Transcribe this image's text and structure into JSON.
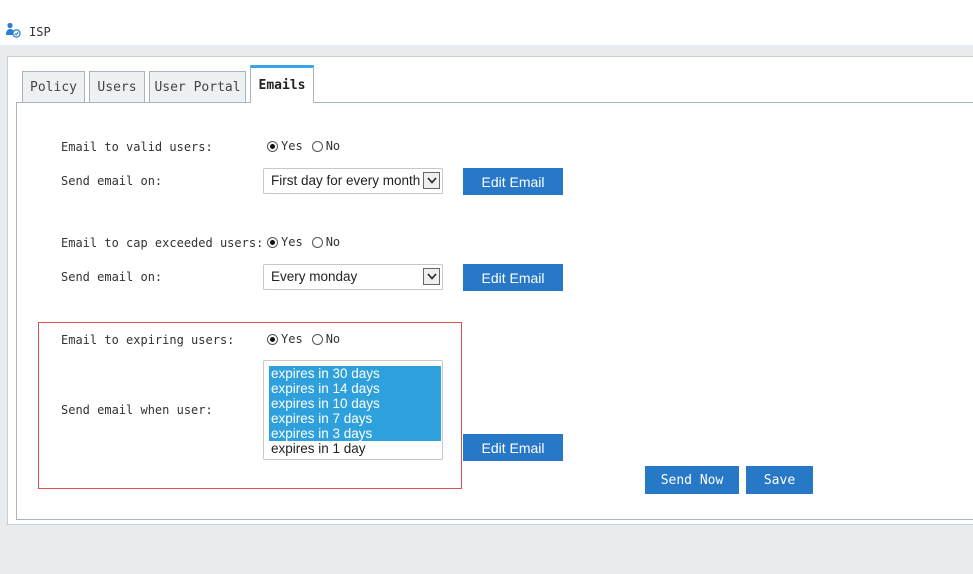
{
  "app": {
    "title": "ISP",
    "icon": "user-check-icon"
  },
  "tabs": [
    {
      "label": "Policy",
      "active": false
    },
    {
      "label": "Users",
      "active": false
    },
    {
      "label": "User Portal",
      "active": false
    },
    {
      "label": "Emails",
      "active": true
    }
  ],
  "radio_options": {
    "yes": "Yes",
    "no": "No"
  },
  "valid_users": {
    "label": "Email to valid users:",
    "selected": "Yes",
    "send_on_label": "Send email on:",
    "send_on_value": "First day for every month",
    "edit_label": "Edit Email"
  },
  "cap_users": {
    "label": "Email to cap exceeded users:",
    "selected": "Yes",
    "send_on_label": "Send email on:",
    "send_on_value": "Every monday",
    "edit_label": "Edit Email"
  },
  "expiring_users": {
    "label": "Email to expiring users:",
    "selected": "Yes",
    "when_label": "Send email when user:",
    "options": [
      {
        "label": "expires in 30 days",
        "selected": true
      },
      {
        "label": "expires in 14 days",
        "selected": true
      },
      {
        "label": "expires in 10 days",
        "selected": true
      },
      {
        "label": "expires in 7 days",
        "selected": true
      },
      {
        "label": "expires in 3 days",
        "selected": true
      },
      {
        "label": "expires in 1 day",
        "selected": false
      }
    ],
    "edit_label": "Edit Email"
  },
  "actions": {
    "send_now": "Send Now",
    "save": "Save"
  },
  "colors": {
    "button": "#2878c8",
    "selection": "#2ea0dc",
    "active_tab_accent": "#3aa3e8",
    "highlight_border": "#d9534f"
  }
}
